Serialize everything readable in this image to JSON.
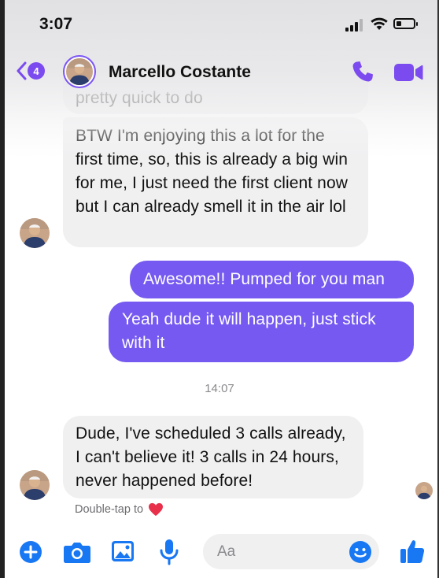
{
  "status_bar": {
    "time": "3:07"
  },
  "header": {
    "back_badge_count": "4",
    "contact_name": "Marcello Costante",
    "icons": [
      "back-chevron-icon",
      "phone-icon",
      "video-camera-icon"
    ]
  },
  "messages": [
    {
      "from": "them",
      "text": "pretty quick to do"
    },
    {
      "from": "them",
      "text": "BTW I'm enjoying this a lot for the first time, so, this is already a big win for me, I just need the first client now but I can already smell it in the air lol"
    },
    {
      "from": "me",
      "text": "Awesome!! Pumped for you man"
    },
    {
      "from": "me",
      "text": "Yeah dude it will happen, just stick with it"
    },
    {
      "from": "them",
      "text": "Dude, I've scheduled 3 calls already, I can't believe it! 3 calls in 24 hours, never happened before!"
    }
  ],
  "timestamp": "14:07",
  "hint": {
    "text": "Double-tap to",
    "icon": "heart-icon"
  },
  "composer": {
    "placeholder": "Aa",
    "icons": [
      "plus-icon",
      "camera-icon",
      "gallery-icon",
      "microphone-icon",
      "emoji-icon",
      "thumbs-up-icon"
    ]
  },
  "colors": {
    "accent": "#7659f1",
    "incoming_bubble": "#f0f0f1",
    "outgoing_text": "#ffffff"
  }
}
